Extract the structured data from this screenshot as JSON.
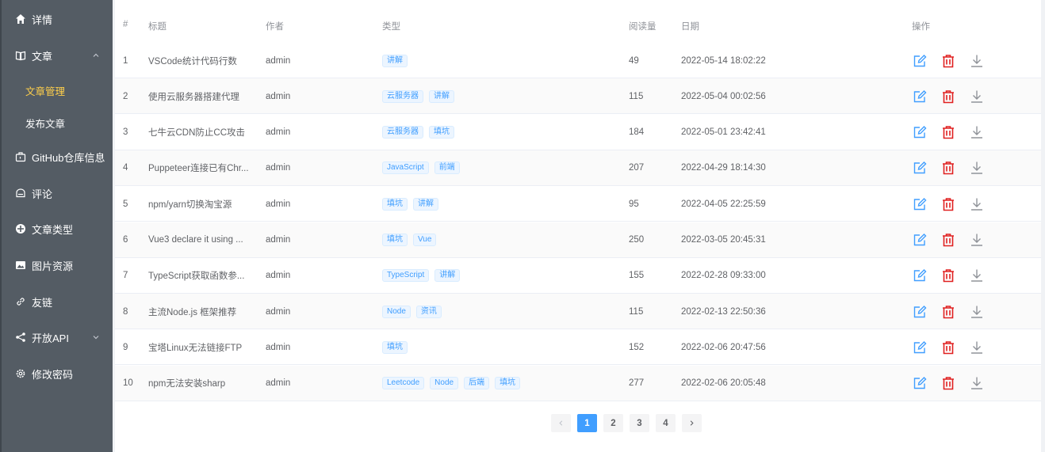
{
  "sidebar": {
    "items": [
      {
        "label": "详情",
        "icon": "home-icon"
      },
      {
        "label": "文章",
        "icon": "book-icon",
        "expanded": true
      },
      {
        "label": "GitHub仓库信息",
        "icon": "briefcase-icon"
      },
      {
        "label": "评论",
        "icon": "message-icon"
      },
      {
        "label": "文章类型",
        "icon": "category-icon"
      },
      {
        "label": "图片资源",
        "icon": "picture-icon"
      },
      {
        "label": "友链",
        "icon": "link-icon"
      },
      {
        "label": "开放API",
        "icon": "share-icon"
      },
      {
        "label": "修改密码",
        "icon": "gear-icon"
      }
    ],
    "sub_items": [
      {
        "label": "文章管理",
        "active": true
      },
      {
        "label": "发布文章",
        "active": false
      }
    ]
  },
  "table": {
    "headers": {
      "index": "#",
      "title": "标题",
      "author": "作者",
      "type": "类型",
      "reads": "阅读量",
      "date": "日期",
      "ops": "操作"
    },
    "rows": [
      {
        "index": "1",
        "title": "VSCode统计代码行数",
        "author": "admin",
        "tags": [
          "讲解"
        ],
        "reads": "49",
        "date": "2022-05-14 18:02:22"
      },
      {
        "index": "2",
        "title": "使用云服务器搭建代理",
        "author": "admin",
        "tags": [
          "云服务器",
          "讲解"
        ],
        "reads": "115",
        "date": "2022-05-04 00:02:56"
      },
      {
        "index": "3",
        "title": "七牛云CDN防止CC攻击",
        "author": "admin",
        "tags": [
          "云服务器",
          "填坑"
        ],
        "reads": "184",
        "date": "2022-05-01 23:42:41"
      },
      {
        "index": "4",
        "title": "Puppeteer连接已有Chr...",
        "author": "admin",
        "tags": [
          "JavaScript",
          "前端"
        ],
        "reads": "207",
        "date": "2022-04-29 18:14:30"
      },
      {
        "index": "5",
        "title": "npm/yarn切换淘宝源",
        "author": "admin",
        "tags": [
          "填坑",
          "讲解"
        ],
        "reads": "95",
        "date": "2022-04-05 22:25:59"
      },
      {
        "index": "6",
        "title": "Vue3 declare it using ...",
        "author": "admin",
        "tags": [
          "填坑",
          "Vue"
        ],
        "reads": "250",
        "date": "2022-03-05 20:45:31"
      },
      {
        "index": "7",
        "title": "TypeScript获取函数参...",
        "author": "admin",
        "tags": [
          "TypeScript",
          "讲解"
        ],
        "reads": "155",
        "date": "2022-02-28 09:33:00"
      },
      {
        "index": "8",
        "title": "主流Node.js 框架推荐",
        "author": "admin",
        "tags": [
          "Node",
          "资讯"
        ],
        "reads": "115",
        "date": "2022-02-13 22:50:36"
      },
      {
        "index": "9",
        "title": "宝塔Linux无法链接FTP",
        "author": "admin",
        "tags": [
          "填坑"
        ],
        "reads": "152",
        "date": "2022-02-06 20:47:56"
      },
      {
        "index": "10",
        "title": "npm无法安装sharp",
        "author": "admin",
        "tags": [
          "Leetcode",
          "Node",
          "后端",
          "填坑"
        ],
        "reads": "277",
        "date": "2022-02-06 20:05:48"
      }
    ],
    "op_icons": [
      "edit-icon",
      "delete-icon",
      "download-icon"
    ]
  },
  "pagination": {
    "pages": [
      "1",
      "2",
      "3",
      "4"
    ],
    "current": "1"
  },
  "colors": {
    "sidebar_bg": "#545c64",
    "active_menu": "#ffd04b",
    "primary": "#409eff",
    "danger": "#e02020"
  }
}
